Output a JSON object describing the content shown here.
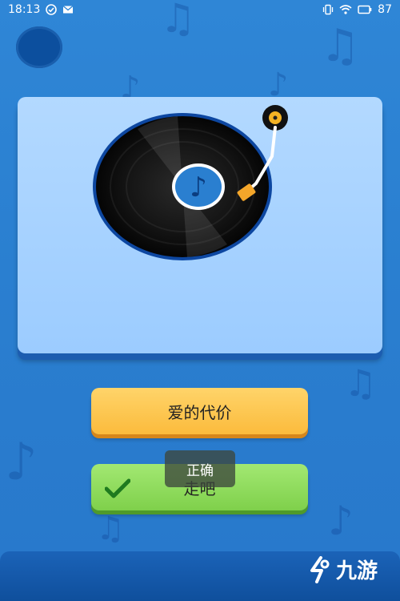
{
  "status_bar": {
    "time": "18:13",
    "battery": "87",
    "left_icons": [
      "check-circle-icon",
      "mail-icon"
    ],
    "right_icons": [
      "vibrate-icon",
      "wifi-icon",
      "battery-icon"
    ]
  },
  "options": [
    {
      "label": "爱的代价"
    },
    {
      "label": "走吧",
      "state": "correct"
    }
  ],
  "toast": {
    "text": "正确"
  },
  "watermark": {
    "text": "九游"
  },
  "colors": {
    "background": "#2a7fd0",
    "panel": "#a8d3ff",
    "option_yellow": "#fbbb3c",
    "option_green": "#7fd04b",
    "record_black": "#111111",
    "label_blue": "#2a7fd0"
  }
}
